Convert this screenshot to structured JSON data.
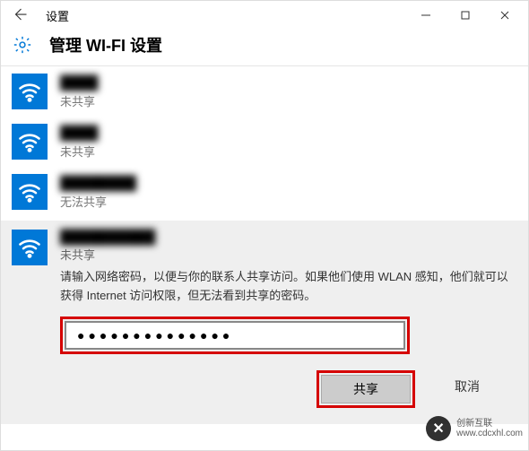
{
  "titlebar": {
    "title": "设置"
  },
  "header": {
    "title": "管理 WI-FI 设置"
  },
  "networks": [
    {
      "name": "████",
      "status": "未共享"
    },
    {
      "name": "████",
      "status": "未共享"
    },
    {
      "name": "████████",
      "status": "无法共享"
    }
  ],
  "selected": {
    "name": "██████████",
    "status": "未共享",
    "description": "请输入网络密码，以便与你的联系人共享访问。如果他们使用 WLAN 感知，他们就可以获得 Internet 访问权限，但无法看到共享的密码。",
    "password_value": "●●●●●●●●●●●●●●",
    "share_label": "共享",
    "cancel_label": "取消"
  },
  "watermark": {
    "line1": "创新互联",
    "line2": "www.cdcxhl.com"
  }
}
